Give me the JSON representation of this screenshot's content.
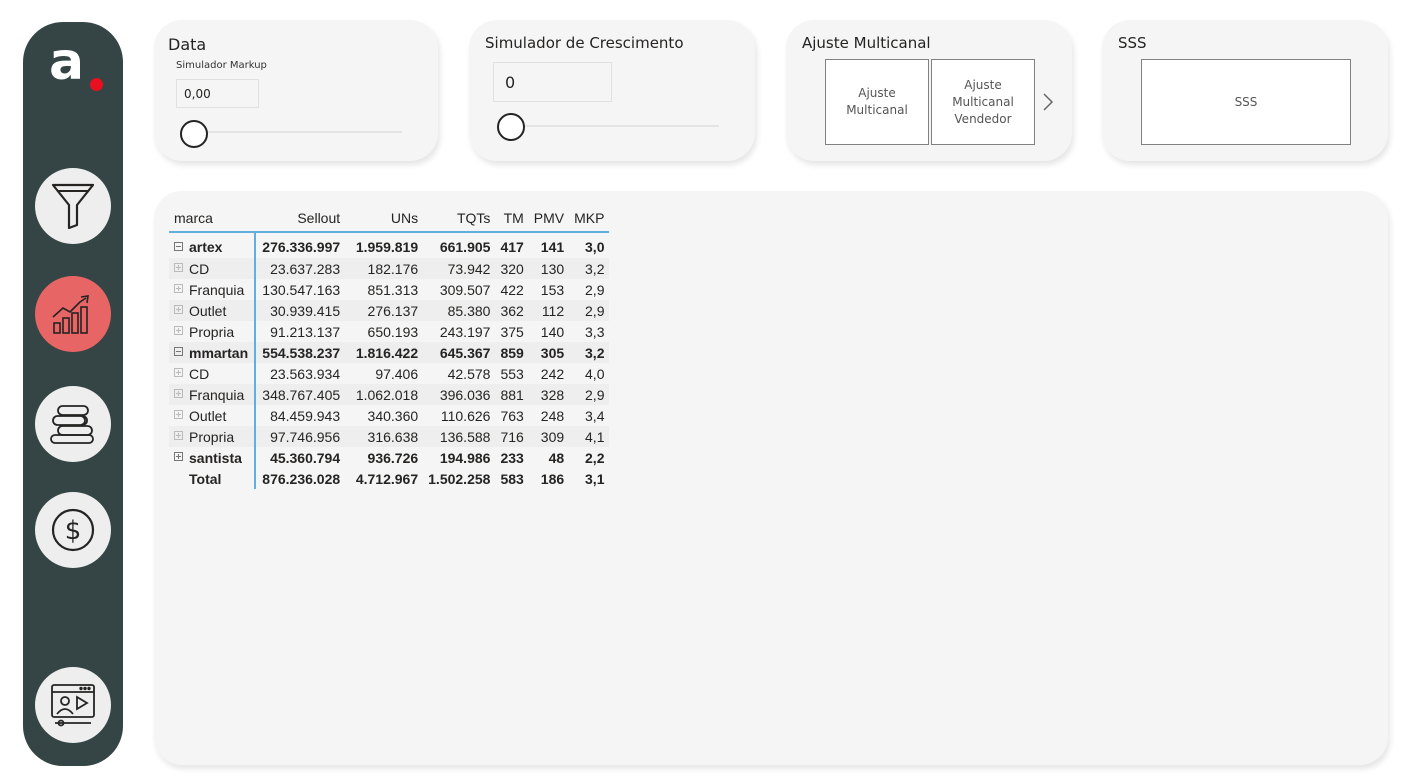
{
  "sidebar": {
    "logo_text": "a",
    "brand_dot_color": "#e8101f",
    "background_color": "#354444",
    "active_color": "#e86565",
    "items": [
      {
        "name": "filter",
        "icon": "funnel-icon",
        "active": false
      },
      {
        "name": "growth",
        "icon": "growth-chart-icon",
        "active": true
      },
      {
        "name": "products",
        "icon": "towels-stack-icon",
        "active": false
      },
      {
        "name": "finance",
        "icon": "dollar-coin-icon",
        "active": false
      },
      {
        "name": "presentation",
        "icon": "video-presentation-icon",
        "active": false
      }
    ]
  },
  "cards": {
    "data": {
      "title": "Data",
      "markup_label": "Simulador Markup",
      "markup_value": "0,00"
    },
    "growth": {
      "title": "Simulador de Crescimento",
      "value": "0"
    },
    "multichannel": {
      "title": "Ajuste Multicanal",
      "tiles": [
        "Ajuste Multicanal",
        "Ajuste Multicanal Vendedor"
      ]
    },
    "sss": {
      "title": "SSS",
      "tile": "SSS"
    }
  },
  "matrix": {
    "columns": [
      "marca",
      "Sellout",
      "UNs",
      "TQTs",
      "TM",
      "PMV",
      "MKP"
    ],
    "rows": [
      {
        "label": "artex",
        "level": 0,
        "expanded": true,
        "bold": true,
        "values": [
          "276.336.997",
          "1.959.819",
          "661.905",
          "417",
          "141",
          "3,0"
        ]
      },
      {
        "label": "CD",
        "level": 1,
        "values": [
          "23.637.283",
          "182.176",
          "73.942",
          "320",
          "130",
          "3,2"
        ]
      },
      {
        "label": "Franquia",
        "level": 1,
        "values": [
          "130.547.163",
          "851.313",
          "309.507",
          "422",
          "153",
          "2,9"
        ]
      },
      {
        "label": "Outlet",
        "level": 1,
        "values": [
          "30.939.415",
          "276.137",
          "85.380",
          "362",
          "112",
          "2,9"
        ]
      },
      {
        "label": "Propria",
        "level": 1,
        "values": [
          "91.213.137",
          "650.193",
          "243.197",
          "375",
          "140",
          "3,3"
        ]
      },
      {
        "label": "mmartan",
        "level": 0,
        "expanded": true,
        "bold": true,
        "values": [
          "554.538.237",
          "1.816.422",
          "645.367",
          "859",
          "305",
          "3,2"
        ]
      },
      {
        "label": "CD",
        "level": 1,
        "values": [
          "23.563.934",
          "97.406",
          "42.578",
          "553",
          "242",
          "4,0"
        ]
      },
      {
        "label": "Franquia",
        "level": 1,
        "values": [
          "348.767.405",
          "1.062.018",
          "396.036",
          "881",
          "328",
          "2,9"
        ]
      },
      {
        "label": "Outlet",
        "level": 1,
        "values": [
          "84.459.943",
          "340.360",
          "110.626",
          "763",
          "248",
          "3,4"
        ]
      },
      {
        "label": "Propria",
        "level": 1,
        "values": [
          "97.746.956",
          "316.638",
          "136.588",
          "716",
          "309",
          "4,1"
        ]
      },
      {
        "label": "santista",
        "level": 0,
        "expanded": false,
        "bold": true,
        "values": [
          "45.360.794",
          "936.726",
          "194.986",
          "233",
          "48",
          "2,2"
        ]
      },
      {
        "label": "Total",
        "level": -1,
        "bold": true,
        "values": [
          "876.236.028",
          "4.712.967",
          "1.502.258",
          "583",
          "186",
          "3,1"
        ]
      }
    ]
  }
}
